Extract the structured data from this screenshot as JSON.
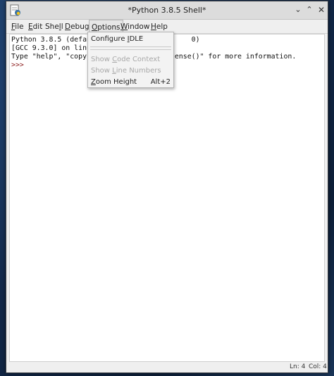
{
  "window": {
    "title": "*Python 3.8.5 Shell*",
    "min_glyph": "⌄",
    "max_glyph": "⌃",
    "close_glyph": "✕"
  },
  "menubar": {
    "items": [
      {
        "pre": "",
        "mn": "F",
        "post": "ile"
      },
      {
        "pre": "",
        "mn": "E",
        "post": "dit"
      },
      {
        "pre": "She",
        "mn": "l",
        "post": "l"
      },
      {
        "pre": "",
        "mn": "D",
        "post": "ebug"
      },
      {
        "pre": "",
        "mn": "O",
        "post": "ptions"
      },
      {
        "pre": "",
        "mn": "W",
        "post": "indow"
      },
      {
        "pre": "",
        "mn": "H",
        "post": "elp"
      }
    ]
  },
  "editor": {
    "lines": [
      "Python 3.8.5 (defaul                       0)",
      "[GCC 9.3.0] on linux",
      "Type \"help\", \"copyri                   ense()\" for more information."
    ],
    "prompt": ">>>"
  },
  "options_menu": {
    "items": [
      {
        "pre": "Configure ",
        "mn": "I",
        "post": "DLE",
        "disabled": false,
        "accel": ""
      },
      {
        "pre": "Show ",
        "mn": "C",
        "post": "ode Context",
        "disabled": true,
        "accel": ""
      },
      {
        "pre": "Show ",
        "mn": "L",
        "post": "ine Numbers",
        "disabled": true,
        "accel": ""
      },
      {
        "pre": "",
        "mn": "Z",
        "post": "oom Height",
        "disabled": false,
        "accel": "Alt+2"
      }
    ]
  },
  "status": {
    "line": "Ln: 4",
    "col": "Col: 4"
  }
}
